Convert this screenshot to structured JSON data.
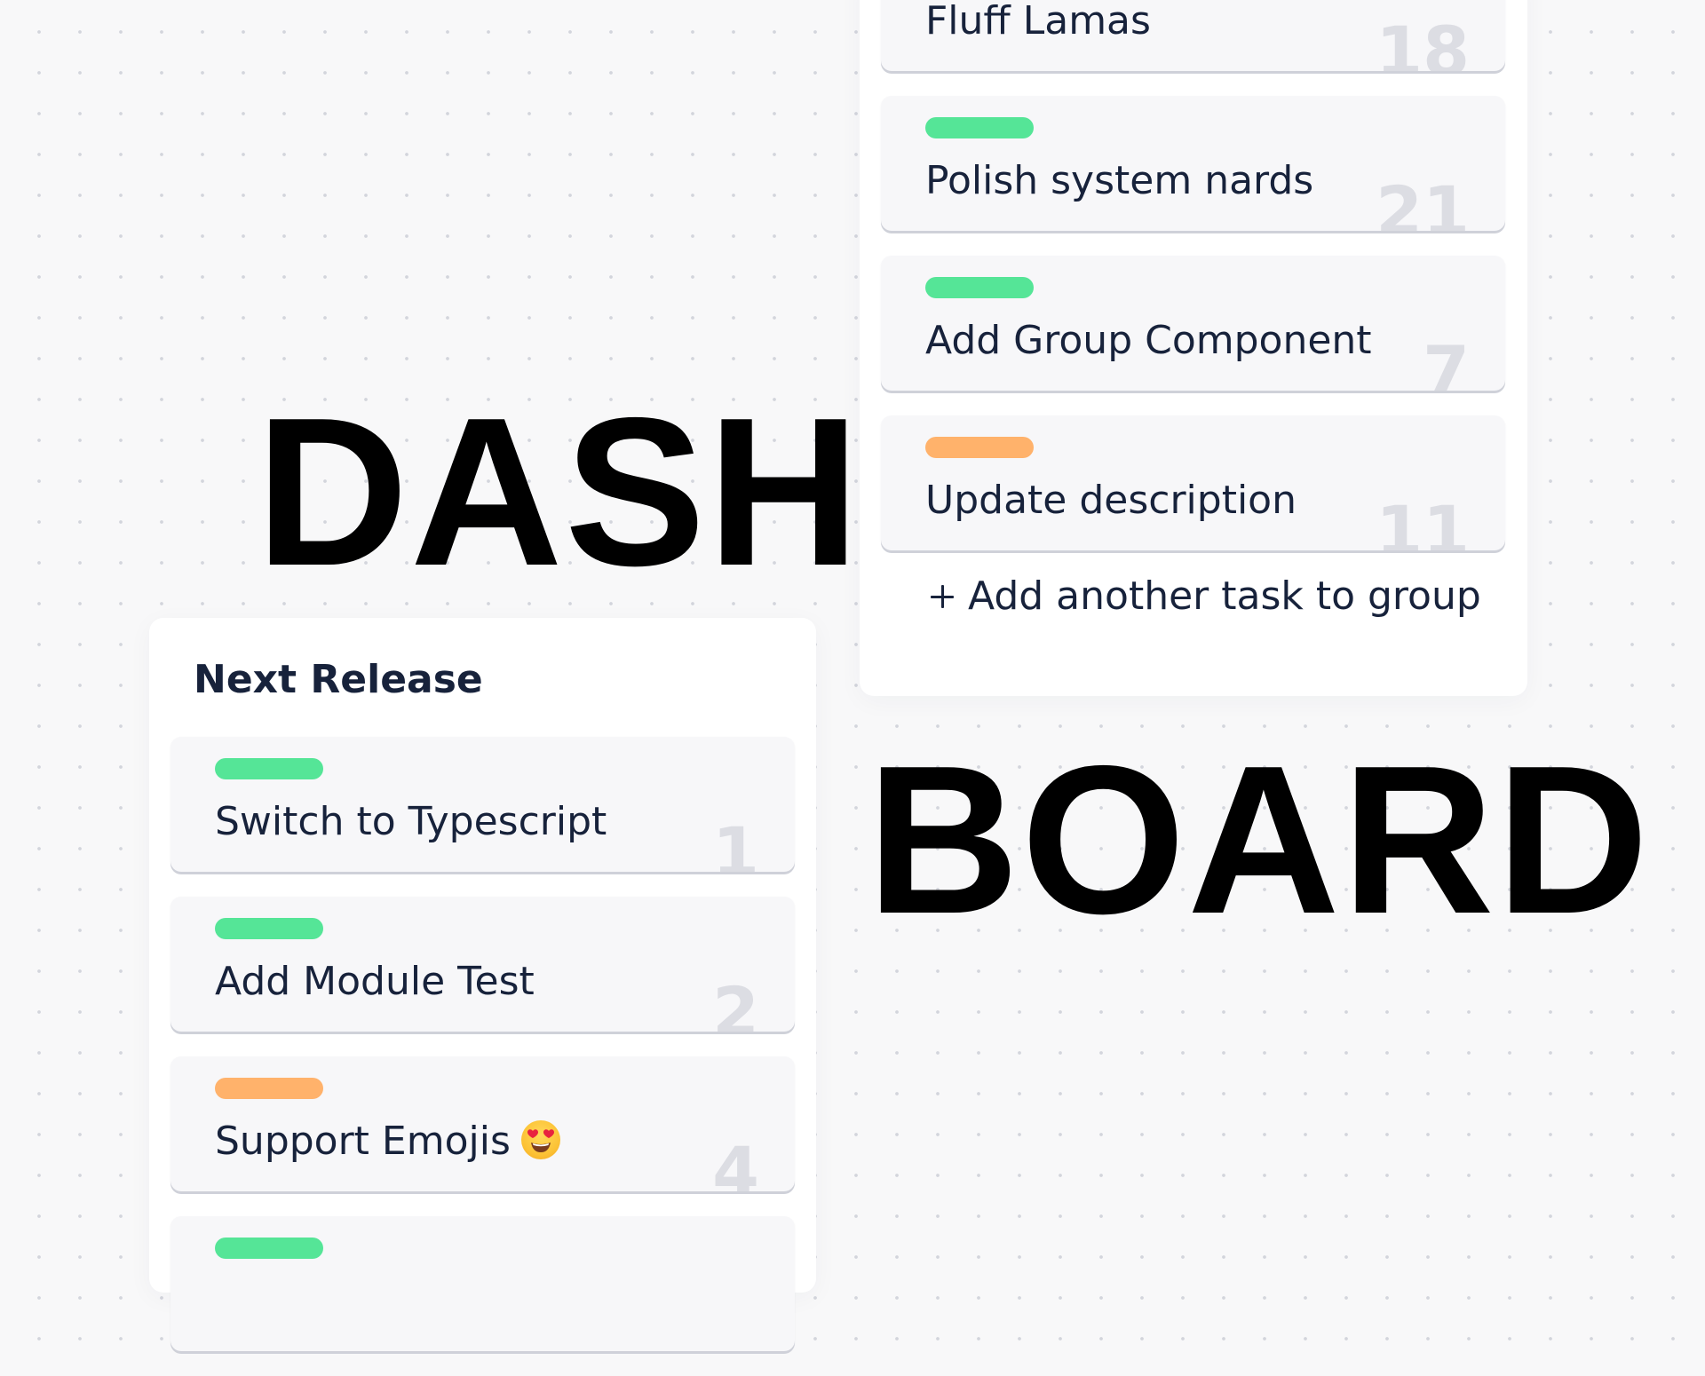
{
  "headline": {
    "top": "DASH",
    "bottom": "BOARD"
  },
  "colors": {
    "text": "#17223b",
    "tag_green": "#55e597",
    "tag_orange": "#ffb26b",
    "card_background": "#f7f7f9",
    "number": "#dcdde3"
  },
  "right_group": {
    "tasks": [
      {
        "title": "Fluff Lamas",
        "number": "18",
        "tag": ""
      },
      {
        "title": "Polish system nards",
        "number": "21",
        "tag": "green"
      },
      {
        "title": "Add Group Component",
        "number": "7",
        "tag": "green"
      },
      {
        "title": "Update description",
        "number": "11",
        "tag": "orange"
      }
    ],
    "add_task_label": "Add another task to group",
    "add_task_icon": "plus-icon"
  },
  "left_group": {
    "title": "Next Release",
    "tasks": [
      {
        "title": "Switch to Typescript",
        "number": "1",
        "tag": "green"
      },
      {
        "title": "Add Module Test",
        "number": "2",
        "tag": "green"
      },
      {
        "title": "Support Emojis",
        "number": "4",
        "tag": "orange",
        "emoji": "heart-eyes-emoji-icon"
      },
      {
        "title": "",
        "number": "",
        "tag": "green"
      }
    ]
  }
}
